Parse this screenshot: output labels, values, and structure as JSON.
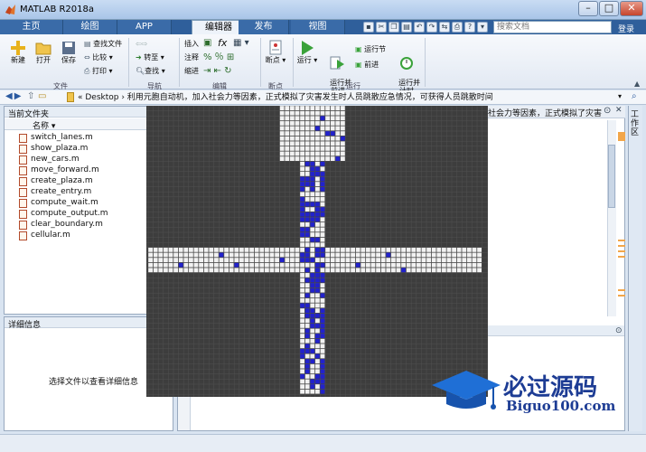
{
  "window": {
    "title": "MATLAB R2018a",
    "buttons": [
      "–",
      "□",
      "✕"
    ]
  },
  "tabs": [
    {
      "label": "主页"
    },
    {
      "label": "绘图"
    },
    {
      "label": "APP"
    },
    {
      "label": "编辑器"
    },
    {
      "label": "发布"
    },
    {
      "label": "视图"
    }
  ],
  "search": {
    "placeholder": "搜索文档"
  },
  "login": "登录",
  "ribbon": {
    "file": {
      "new": "新建",
      "open": "打开",
      "save": "保存",
      "find_files": "查找文件",
      "compare": "比较",
      "print": "打印",
      "group": "文件"
    },
    "nav": {
      "goto": "转至",
      "find": "查找",
      "group": "导航"
    },
    "edit": {
      "insert": "插入",
      "comment": "注释",
      "indent": "缩进",
      "fx": "fx",
      "group": "编辑"
    },
    "breakpoints": {
      "label": "断点",
      "group": "断点"
    },
    "run": {
      "run": "运行",
      "run_advance": "运行并\n前进",
      "run_section": "运行节",
      "advance": "前进",
      "run_time": "运行并\n计时",
      "group": "运行"
    }
  },
  "address": {
    "path": "« Desktop › 利用元胞自动机，加入社会力等因素，正式模拟了灾害发生时人员跳散应急情况，可获得人员跳散时间"
  },
  "current_folder": {
    "title": "当前文件夹",
    "column": "名称"
  },
  "files": [
    "switch_lanes.m",
    "show_plaza.m",
    "new_cars.m",
    "move_forward.m",
    "create_plaza.m",
    "create_entry.m",
    "compute_wait.m",
    "compute_output.m",
    "clear_boundary.m",
    "cellular.m"
  ],
  "details": {
    "title": "详细信息",
    "hint": "选择文件以查看详细信息"
  },
  "editor_tab": {
    "label": "社会力等因素，正式模拟了灾害..."
  },
  "workspace": {
    "label": "工作区"
  },
  "watermark": {
    "title": "必过源码",
    "url": "Biguo100.com"
  },
  "colors": {
    "occupied": "#2222cc",
    "empty": "#f2f2f2",
    "wall": "#3d3d3d"
  }
}
